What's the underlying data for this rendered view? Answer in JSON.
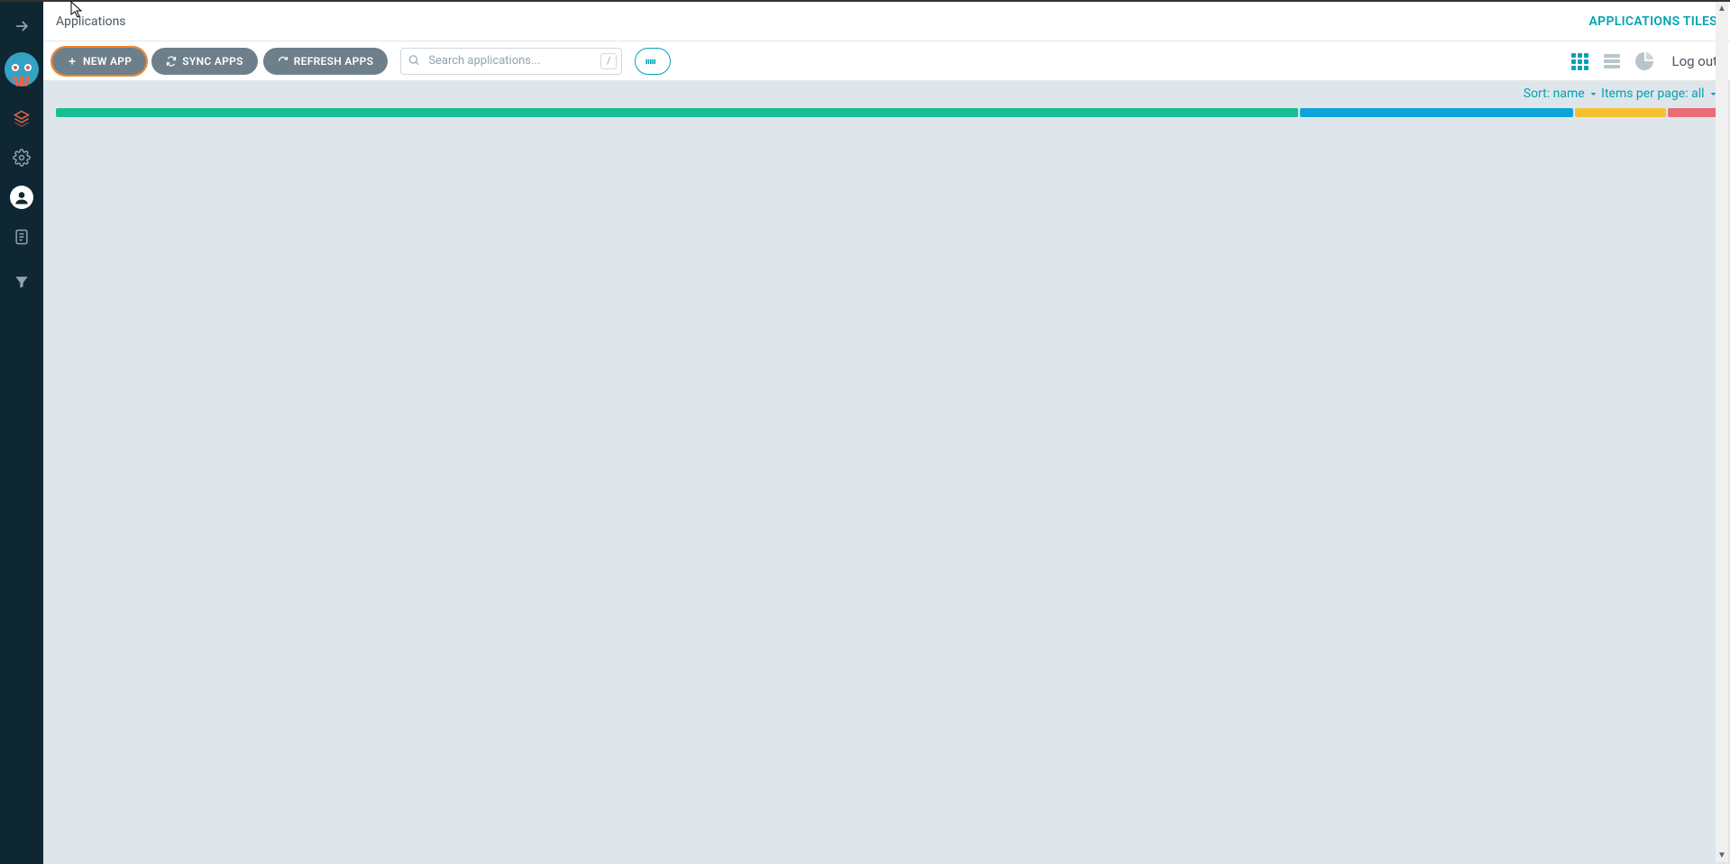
{
  "header": {
    "breadcrumb": "Applications",
    "view_label": "APPLICATIONS TILES"
  },
  "toolbar": {
    "new_app": "NEW APP",
    "sync_apps": "SYNC APPS",
    "refresh_apps": "REFRESH APPS",
    "search_placeholder": "Search applications...",
    "kbd_hint": "/",
    "logout_label": "Log out"
  },
  "subbar": {
    "sort_label": "Sort:",
    "sort_value": "name",
    "items_label": "Items per page:",
    "items_value": "all"
  },
  "status": {
    "green_pct": 75,
    "blue_pct": 16.5,
    "yellow_pct": 5.5,
    "red_pct": 3
  },
  "colors": {
    "accent": "#00a2b3",
    "sidebar": "#0f2733",
    "btn": "#6d7f8b",
    "highlight": "#f08429"
  }
}
